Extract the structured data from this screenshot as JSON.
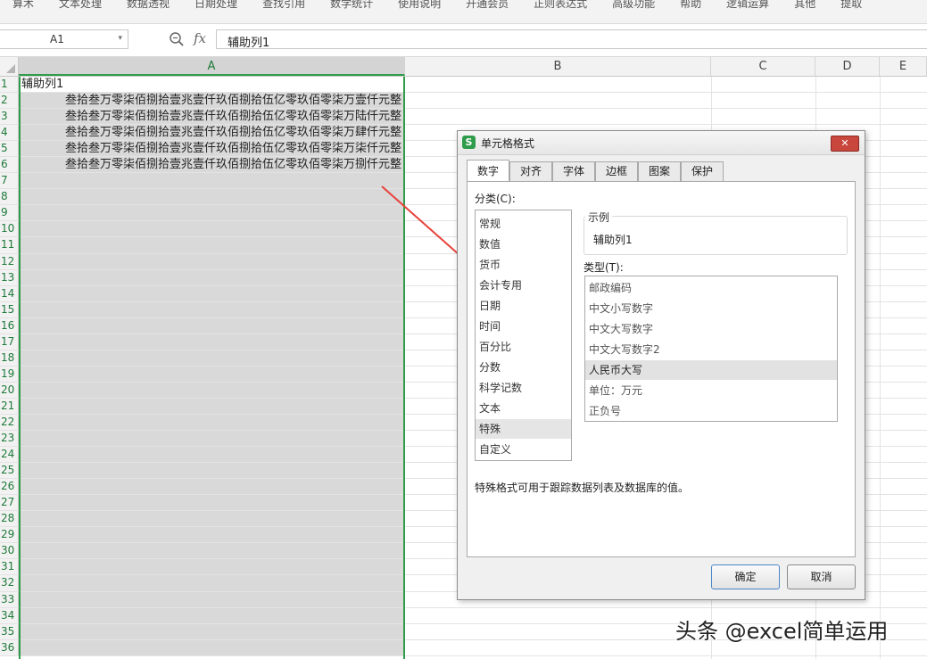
{
  "ribbon": {
    "items": [
      "算术",
      "文本处理",
      "数据透视",
      "日期处理",
      "查找引用",
      "数学统计",
      "使用说明",
      "开通会员",
      "正则表达式",
      "高级功能",
      "帮助",
      "逻辑运算",
      "其他",
      "提取"
    ]
  },
  "formula_bar": {
    "cell_ref": "A1",
    "fx_label": "fx",
    "content": "辅助列1"
  },
  "columns": [
    "A",
    "B",
    "C",
    "D",
    "E"
  ],
  "rows": [
    {
      "n": "1",
      "a": "辅助列1"
    },
    {
      "n": "2",
      "a": "叁拾叁万零柒佰捌拾壹兆壹仟玖佰捌拾伍亿零玖佰零柒万壹仟元整"
    },
    {
      "n": "3",
      "a": "叁拾叁万零柒佰捌拾壹兆壹仟玖佰捌拾伍亿零玖佰零柒万陆仟元整"
    },
    {
      "n": "4",
      "a": "叁拾叁万零柒佰捌拾壹兆壹仟玖佰捌拾伍亿零玖佰零柒万肆仟元整"
    },
    {
      "n": "5",
      "a": "叁拾叁万零柒佰捌拾壹兆壹仟玖佰捌拾伍亿零玖佰零柒万柒仟元整"
    },
    {
      "n": "6",
      "a": "叁拾叁万零柒佰捌拾壹兆壹仟玖佰捌拾伍亿零玖佰零柒万捌仟元整"
    },
    {
      "n": "7",
      "a": ""
    },
    {
      "n": "8",
      "a": ""
    },
    {
      "n": "9",
      "a": ""
    },
    {
      "n": "10",
      "a": ""
    },
    {
      "n": "11",
      "a": ""
    },
    {
      "n": "12",
      "a": ""
    },
    {
      "n": "13",
      "a": ""
    },
    {
      "n": "14",
      "a": ""
    },
    {
      "n": "15",
      "a": ""
    },
    {
      "n": "16",
      "a": ""
    },
    {
      "n": "17",
      "a": ""
    },
    {
      "n": "18",
      "a": ""
    },
    {
      "n": "19",
      "a": ""
    },
    {
      "n": "20",
      "a": ""
    },
    {
      "n": "21",
      "a": ""
    },
    {
      "n": "22",
      "a": ""
    },
    {
      "n": "23",
      "a": ""
    },
    {
      "n": "24",
      "a": ""
    },
    {
      "n": "25",
      "a": ""
    },
    {
      "n": "26",
      "a": ""
    },
    {
      "n": "27",
      "a": ""
    },
    {
      "n": "28",
      "a": ""
    },
    {
      "n": "29",
      "a": ""
    },
    {
      "n": "30",
      "a": ""
    },
    {
      "n": "31",
      "a": ""
    },
    {
      "n": "32",
      "a": ""
    },
    {
      "n": "33",
      "a": ""
    },
    {
      "n": "34",
      "a": ""
    },
    {
      "n": "35",
      "a": ""
    },
    {
      "n": "36",
      "a": ""
    }
  ],
  "dialog": {
    "title": "单元格格式",
    "app_icon_letter": "S",
    "close_glyph": "✕",
    "tabs": [
      "数字",
      "对齐",
      "字体",
      "边框",
      "图案",
      "保护"
    ],
    "category_label": "分类(C):",
    "categories": [
      "常规",
      "数值",
      "货币",
      "会计专用",
      "日期",
      "时间",
      "百分比",
      "分数",
      "科学记数",
      "文本",
      "特殊",
      "自定义"
    ],
    "selected_category": "特殊",
    "sample_label": "示例",
    "sample_value": "辅助列1",
    "type_label": "类型(T):",
    "types": [
      "邮政编码",
      "中文小写数字",
      "中文大写数字",
      "中文大写数字2",
      "人民币大写",
      "单位：万元",
      "正负号"
    ],
    "selected_type": "人民币大写",
    "description": "特殊格式可用于跟踪数据列表及数据库的值。",
    "ok_label": "确定",
    "cancel_label": "取消"
  },
  "watermark": "头条 @excel简单运用",
  "colors": {
    "accent_green": "#2e9c4a",
    "arrow_red": "#e8413a",
    "selection_gray": "#d9d9d9"
  }
}
